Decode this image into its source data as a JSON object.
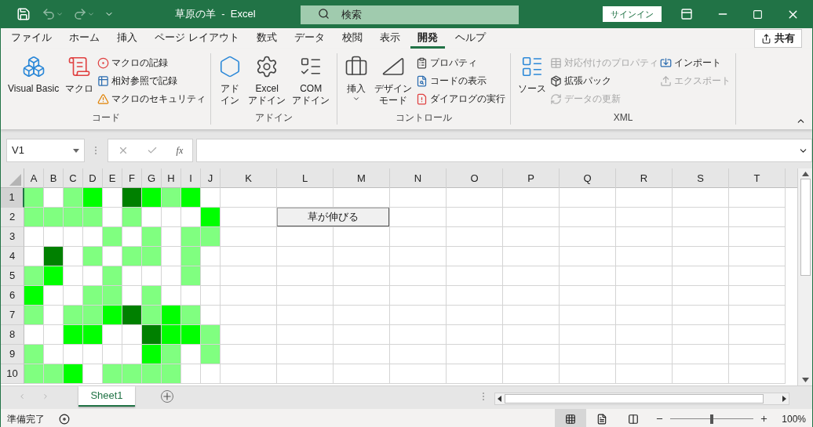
{
  "window": {
    "title": "草原の羊  -  Excel",
    "search_placeholder": "検索",
    "sign_in": "サインイン"
  },
  "menu_tabs": [
    {
      "label": "ファイル",
      "selected": false
    },
    {
      "label": "ホーム",
      "selected": false
    },
    {
      "label": "挿入",
      "selected": false
    },
    {
      "label": "ページ レイアウト",
      "selected": false
    },
    {
      "label": "数式",
      "selected": false
    },
    {
      "label": "データ",
      "selected": false
    },
    {
      "label": "校閲",
      "selected": false
    },
    {
      "label": "表示",
      "selected": false
    },
    {
      "label": "開発",
      "selected": true
    },
    {
      "label": "ヘルプ",
      "selected": false
    }
  ],
  "share_button": "共有",
  "ribbon_groups": [
    {
      "label": "コード",
      "items": [
        {
          "kind": "large",
          "lines": [
            "Visual Basic"
          ],
          "dropdown": false
        },
        {
          "kind": "large",
          "lines": [
            "マクロ"
          ],
          "dropdown": false
        },
        {
          "kind": "stack",
          "items": [
            {
              "label": "マクロの記録",
              "disabled": false
            },
            {
              "label": "相対参照で記録",
              "disabled": false
            },
            {
              "label": "マクロのセキュリティ",
              "disabled": false
            }
          ]
        }
      ]
    },
    {
      "label": "アドイン",
      "items": [
        {
          "kind": "large",
          "lines": [
            "アド",
            "イン"
          ],
          "dropdown": false
        },
        {
          "kind": "large",
          "lines": [
            "Excel",
            "アドイン"
          ],
          "dropdown": false
        },
        {
          "kind": "large",
          "lines": [
            "COM",
            "アドイン"
          ],
          "dropdown": false
        }
      ]
    },
    {
      "label": "コントロール",
      "items": [
        {
          "kind": "large",
          "lines": [
            "挿入"
          ],
          "dropdown": true
        },
        {
          "kind": "large",
          "lines": [
            "デザイン",
            "モード"
          ],
          "dropdown": false
        },
        {
          "kind": "stack",
          "items": [
            {
              "label": "プロパティ",
              "disabled": false
            },
            {
              "label": "コードの表示",
              "disabled": false
            },
            {
              "label": "ダイアログの実行",
              "disabled": false
            }
          ]
        }
      ]
    },
    {
      "label": "XML",
      "items": [
        {
          "kind": "large",
          "lines": [
            "ソース"
          ],
          "dropdown": false
        },
        {
          "kind": "stack",
          "items": [
            {
              "label": "対応付けのプロパティ",
              "disabled": true
            },
            {
              "label": "拡張パック",
              "disabled": false
            },
            {
              "label": "データの更新",
              "disabled": true
            }
          ]
        },
        {
          "kind": "stack",
          "items": [
            {
              "label": "インポート",
              "disabled": false
            },
            {
              "label": "エクスポート",
              "disabled": true
            }
          ]
        }
      ]
    }
  ],
  "formula_bar": {
    "name_box": "V1",
    "fx": "fx"
  },
  "columns": [
    "A",
    "B",
    "C",
    "D",
    "E",
    "F",
    "G",
    "H",
    "I",
    "J",
    "K",
    "L",
    "M",
    "N",
    "O",
    "P",
    "Q",
    "R",
    "S",
    "T"
  ],
  "rows": [
    {
      "label": "1",
      "selected": true,
      "cells": [
        {
          "color": "#80ff80"
        },
        {
          "color": "#ffffff"
        },
        {
          "color": "#80ff80"
        },
        {
          "color": "#00ff00"
        },
        {
          "color": "#ffffff"
        },
        {
          "color": "#008000"
        },
        {
          "color": "#00ff00"
        },
        {
          "color": "#80ff80"
        },
        {
          "color": "#00ff00"
        },
        {
          "color": "#ffffff"
        }
      ]
    },
    {
      "label": "2",
      "selected": false,
      "cells": [
        {
          "color": "#80ff80"
        },
        {
          "color": "#80ff80"
        },
        {
          "color": "#80ff80"
        },
        {
          "color": "#80ff80"
        },
        {
          "color": "#ffffff"
        },
        {
          "color": "#80ff80"
        },
        {
          "color": "#ffffff"
        },
        {
          "color": "#ffffff"
        },
        {
          "color": "#ffffff"
        },
        {
          "color": "#00ff00"
        }
      ]
    },
    {
      "label": "3",
      "selected": false,
      "cells": [
        {
          "color": "#ffffff"
        },
        {
          "color": "#ffffff"
        },
        {
          "color": "#ffffff"
        },
        {
          "color": "#ffffff"
        },
        {
          "color": "#80ff80"
        },
        {
          "color": "#ffffff"
        },
        {
          "color": "#80ff80"
        },
        {
          "color": "#ffffff"
        },
        {
          "color": "#80ff80"
        },
        {
          "color": "#80ff80"
        }
      ]
    },
    {
      "label": "4",
      "selected": false,
      "cells": [
        {
          "color": "#ffffff"
        },
        {
          "color": "#008000"
        },
        {
          "color": "#ffffff"
        },
        {
          "color": "#80ff80"
        },
        {
          "color": "#ffffff"
        },
        {
          "color": "#80ff80"
        },
        {
          "color": "#80ff80"
        },
        {
          "color": "#ffffff"
        },
        {
          "color": "#80ff80"
        },
        {
          "color": "#ffffff"
        }
      ]
    },
    {
      "label": "5",
      "selected": false,
      "cells": [
        {
          "color": "#80ff80"
        },
        {
          "color": "#00ff00"
        },
        {
          "color": "#ffffff"
        },
        {
          "color": "#ffffff"
        },
        {
          "color": "#80ff80"
        },
        {
          "color": "#ffffff"
        },
        {
          "color": "#ffffff"
        },
        {
          "color": "#ffffff"
        },
        {
          "color": "#80ff80"
        },
        {
          "color": "#ffffff"
        }
      ]
    },
    {
      "label": "6",
      "selected": false,
      "cells": [
        {
          "color": "#00ff00"
        },
        {
          "color": "#ffffff"
        },
        {
          "color": "#ffffff"
        },
        {
          "color": "#80ff80"
        },
        {
          "color": "#80ff80"
        },
        {
          "color": "#ffffff"
        },
        {
          "color": "#80ff80"
        },
        {
          "color": "#ffffff"
        },
        {
          "color": "#ffffff"
        },
        {
          "color": "#ffffff"
        }
      ]
    },
    {
      "label": "7",
      "selected": false,
      "cells": [
        {
          "color": "#80ff80"
        },
        {
          "color": "#ffffff"
        },
        {
          "color": "#80ff80"
        },
        {
          "color": "#80ff80"
        },
        {
          "color": "#00ff00"
        },
        {
          "color": "#008000"
        },
        {
          "color": "#80ff80"
        },
        {
          "color": "#00ff00"
        },
        {
          "color": "#80ff80"
        },
        {
          "color": "#ffffff"
        }
      ]
    },
    {
      "label": "8",
      "selected": false,
      "cells": [
        {
          "color": "#ffffff"
        },
        {
          "color": "#ffffff"
        },
        {
          "color": "#00ff00"
        },
        {
          "color": "#00ff00"
        },
        {
          "color": "#ffffff"
        },
        {
          "color": "#ffffff"
        },
        {
          "color": "#008000"
        },
        {
          "color": "#00ff00"
        },
        {
          "color": "#00ff00"
        },
        {
          "color": "#80ff80"
        }
      ]
    },
    {
      "label": "9",
      "selected": false,
      "cells": [
        {
          "color": "#80ff80"
        },
        {
          "color": "#ffffff"
        },
        {
          "color": "#ffffff"
        },
        {
          "color": "#ffffff"
        },
        {
          "color": "#ffffff"
        },
        {
          "color": "#ffffff"
        },
        {
          "color": "#00ff00"
        },
        {
          "color": "#80ff80"
        },
        {
          "color": "#ffffff"
        },
        {
          "color": "#80ff80"
        }
      ]
    },
    {
      "label": "10",
      "selected": false,
      "cells": [
        {
          "color": "#80ff80"
        },
        {
          "color": "#80ff80"
        },
        {
          "color": "#00ff00"
        },
        {
          "color": "#ffffff"
        },
        {
          "color": "#80ff80"
        },
        {
          "color": "#80ff80"
        },
        {
          "color": "#80ff80"
        },
        {
          "color": "#80ff80"
        },
        {
          "color": "#ffffff"
        },
        {
          "color": "#ffffff"
        }
      ]
    }
  ],
  "sheet_button": "草が伸びる",
  "sheet_tabs": [
    {
      "label": "Sheet1",
      "selected": true
    }
  ],
  "status_bar": {
    "status": "準備完了",
    "views": [
      {
        "selected": true
      },
      {
        "selected": false
      },
      {
        "selected": false
      }
    ],
    "zoom": {
      "level": 0.5,
      "reading": "100%"
    }
  }
}
